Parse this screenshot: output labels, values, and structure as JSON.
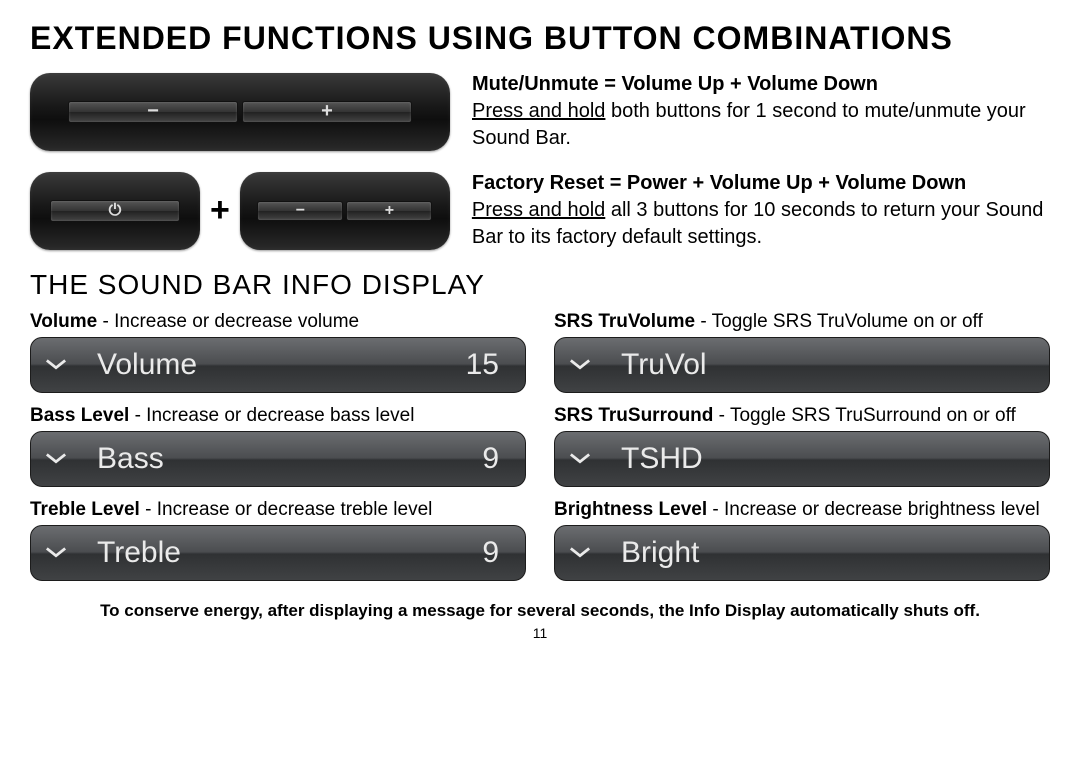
{
  "heading1": "EXTENDED FUNCTIONS USING BUTTON COMBINATIONS",
  "combo1": {
    "title": "Mute/Unmute = Volume Up + Volume Down",
    "action": "Press and hold",
    "rest": " both buttons for 1 second to mute/unmute your Sound Bar."
  },
  "combo2": {
    "title": "Factory Reset = Power + Volume Up + Volume Down",
    "action": "Press and hold",
    "rest": " all 3 buttons for 10 seconds to return your Sound Bar to its factory default settings."
  },
  "heading2": "THE SOUND BAR INFO DISPLAY",
  "left": [
    {
      "descBold": "Volume",
      "descRest": " - Increase or decrease volume",
      "label": "Volume",
      "value": "15"
    },
    {
      "descBold": "Bass Level",
      "descRest": " - Increase or decrease bass level",
      "label": "Bass",
      "value": "9"
    },
    {
      "descBold": "Treble Level",
      "descRest": " - Increase or decrease treble level",
      "label": "Treble",
      "value": "9"
    }
  ],
  "right": [
    {
      "descBold": "SRS TruVolume",
      "descRest": " - Toggle SRS TruVolume on or off",
      "label": "TruVol",
      "value": ""
    },
    {
      "descBold": "SRS TruSurround",
      "descRest": " - Toggle SRS TruSurround on or off",
      "label": "TSHD",
      "value": ""
    },
    {
      "descBold": "Brightness Level",
      "descRest": " - Increase or decrease brightness level",
      "label": "Bright",
      "value": ""
    }
  ],
  "footnote": "To conserve energy, after displaying a message for several seconds, the Info Display automatically shuts off.",
  "page": "11",
  "glyph": {
    "minus": "−",
    "plus": "+",
    "power": "⏻",
    "plusSep": "+"
  }
}
